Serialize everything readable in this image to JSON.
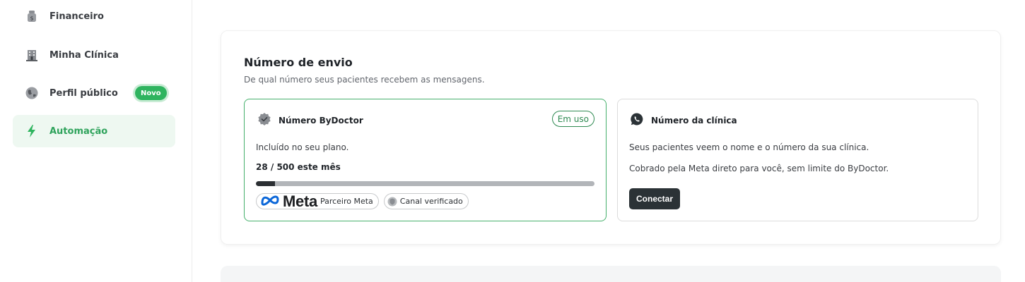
{
  "sidebar": {
    "items": [
      {
        "label": "Financeiro",
        "icon": "money-bag-icon"
      },
      {
        "label": "Minha Clínica",
        "icon": "building-icon"
      },
      {
        "label": "Perfil público",
        "icon": "globe-icon",
        "badge": "Novo"
      },
      {
        "label": "Automação",
        "icon": "lightning-icon",
        "active": true
      }
    ]
  },
  "section": {
    "title": "Número de envio",
    "subtitle": "De qual número seus pacientes recebem as mensagens."
  },
  "options": {
    "bydoctor": {
      "title": "Número ByDoctor",
      "status": "Em uso",
      "description": "Incluído no seu plano.",
      "usage": "28 / 500 este mês",
      "usage_fraction": 0.056,
      "meta_logo_text": "Meta",
      "partner_label": "Parceiro Meta",
      "verified_label": "Canal verificado"
    },
    "clinic": {
      "title": "Número da clínica",
      "line1": "Seus pacientes veem o nome e o número da sua clínica.",
      "line2": "Cobrado pela Meta direto para você, sem limite do ByDoctor.",
      "connect_label": "Conectar"
    }
  },
  "colors": {
    "accent_green": "#2fb45f",
    "active_bg": "#eef8f1",
    "border_green": "#45b06b",
    "dark_button": "#2b3236"
  }
}
